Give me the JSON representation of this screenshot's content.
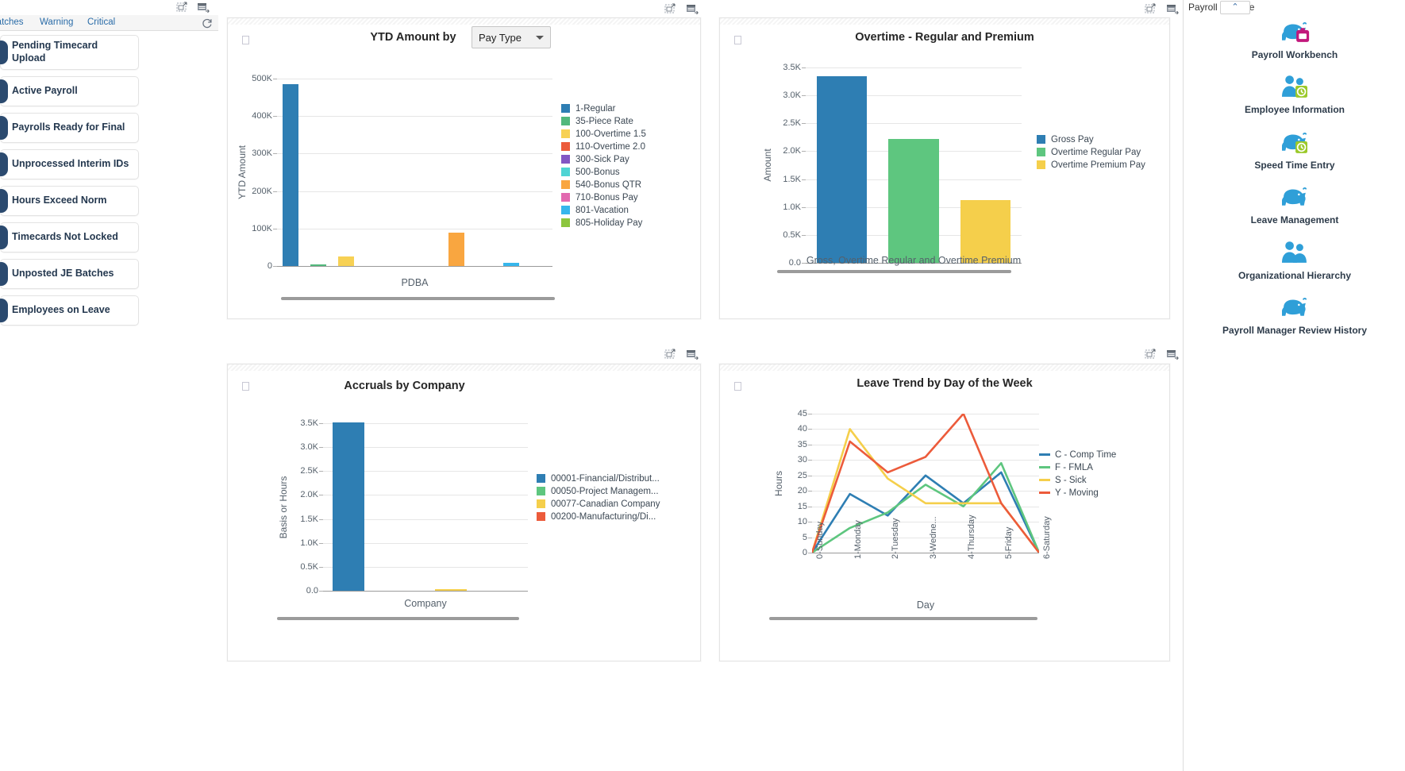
{
  "left_panel": {
    "tabs": [
      {
        "label": "Batches",
        "name": "tab-batches"
      },
      {
        "label": "Warning",
        "name": "tab-warning"
      },
      {
        "label": "Critical",
        "name": "tab-critical"
      }
    ],
    "refresh_icon": "refresh-icon",
    "toolbar_icons": [
      "grid-expand-icon",
      "list-view-icon"
    ],
    "alerts": [
      {
        "label": "Pending Timecard Upload",
        "tall": true
      },
      {
        "label": "Active Payroll",
        "tall": false
      },
      {
        "label": "Payrolls Ready for Final",
        "tall": false
      },
      {
        "label": "Unprocessed Interim IDs",
        "tall": false
      },
      {
        "label": "Hours Exceed Norm",
        "tall": false
      },
      {
        "label": "Timecards Not Locked",
        "tall": false
      },
      {
        "label": "Unposted JE Batches",
        "tall": false
      },
      {
        "label": "Employees on Leave",
        "tall": false
      }
    ]
  },
  "right_panel": {
    "header_title": "Payroll Manage",
    "collapse_label": "⌃",
    "toolbar_icons": [
      "grid-expand-icon",
      "list-view-icon"
    ],
    "items": [
      {
        "label": "Payroll Workbench",
        "icon": "piggy-bank-briefcase-icon"
      },
      {
        "label": "Employee Information",
        "icon": "people-clock-icon"
      },
      {
        "label": "Speed Time Entry",
        "icon": "piggy-bank-clock-icon"
      },
      {
        "label": "Leave Management",
        "icon": "piggy-bank-icon"
      },
      {
        "label": "Organizational Hierarchy",
        "icon": "two-people-icon"
      },
      {
        "label": "Payroll Manager Review History",
        "icon": "piggy-bank-icon"
      }
    ]
  },
  "chart_data": [
    {
      "id": "ytd-amount-by-pay-type",
      "type": "bar",
      "title": "YTD Amount by",
      "selector": {
        "label": "Pay Type",
        "options": [
          "Pay Type"
        ]
      },
      "xlabel": "PDBA",
      "ylabel": "YTD Amount",
      "ylim": [
        0,
        500000
      ],
      "yticks": [
        0,
        100000,
        200000,
        300000,
        400000,
        500000
      ],
      "ytick_labels": [
        "0",
        "100K",
        "200K",
        "300K",
        "400K",
        "500K"
      ],
      "grid": true,
      "legend_position": "right",
      "categories": [
        "1-Regular",
        "35-Piece Rate",
        "100-Overtime 1.5",
        "110-Overtime 2.0",
        "300-Sick Pay",
        "500-Bonus",
        "540-Bonus QTR",
        "710-Bonus Pay",
        "801-Vacation",
        "805-Holiday Pay"
      ],
      "values": [
        486000,
        2500,
        26000,
        0,
        0,
        0,
        90000,
        0,
        8000,
        0
      ],
      "colors": [
        "#2e7eb3",
        "#52b87c",
        "#f7d154",
        "#ec5b3b",
        "#8356c4",
        "#4fd4d4",
        "#f9a640",
        "#e269b0",
        "#36b6ec",
        "#8cc63e"
      ]
    },
    {
      "id": "overtime-regular-and-premium",
      "type": "bar",
      "title": "Overtime - Regular and Premium",
      "xlabel": "Gross, Overtime Regular and Overtime Premium",
      "ylabel": "Amount",
      "ylim": [
        0,
        3500
      ],
      "yticks": [
        0,
        500,
        1000,
        1500,
        2000,
        2500,
        3000,
        3500
      ],
      "ytick_labels": [
        "0.0",
        "0.5K",
        "1.0K",
        "1.5K",
        "2.0K",
        "2.5K",
        "3.0K",
        "3.5K"
      ],
      "grid": true,
      "legend_position": "right",
      "categories": [
        "Gross Pay",
        "Overtime Regular Pay",
        "Overtime Premium Pay"
      ],
      "values": [
        3340,
        2225,
        1125
      ],
      "colors": [
        "#2e7eb3",
        "#5ec67f",
        "#f5cf4b"
      ]
    },
    {
      "id": "accruals-by-company",
      "type": "bar",
      "title": "Accruals by Company",
      "xlabel": "Company",
      "ylabel": "Basis or Hours",
      "ylim": [
        0,
        3500
      ],
      "yticks": [
        0,
        500,
        1000,
        1500,
        2000,
        2500,
        3000,
        3500
      ],
      "ytick_labels": [
        "0.0",
        "0.5K",
        "1.0K",
        "1.5K",
        "2.0K",
        "2.5K",
        "3.0K",
        "3.5K"
      ],
      "grid": true,
      "legend_position": "right",
      "categories": [
        "00001-Financial/Distribut...",
        "00050-Project Managem...",
        "00077-Canadian Company",
        "00200-Manufacturing/Di..."
      ],
      "values": [
        3510,
        0,
        24,
        0
      ],
      "colors": [
        "#2e7eb3",
        "#5ec67f",
        "#f5cf4b",
        "#ec5b3b"
      ]
    },
    {
      "id": "leave-trend-by-day-of-the-week",
      "type": "line",
      "title": "Leave Trend by Day of the Week",
      "xlabel": "Day",
      "ylabel": "Hours",
      "ylim": [
        0,
        45
      ],
      "yticks": [
        0,
        5,
        10,
        15,
        20,
        25,
        30,
        35,
        40,
        45
      ],
      "ytick_labels": [
        "0",
        "5",
        "10",
        "15",
        "20",
        "25",
        "30",
        "35",
        "40",
        "45"
      ],
      "grid": true,
      "legend_position": "right",
      "x": [
        "0-Sunday",
        "1-Monday",
        "2-Tuesday",
        "3-Wedne...",
        "4-Thursday",
        "5-Friday",
        "6-Saturday"
      ],
      "series": [
        {
          "name": "C - Comp Time",
          "color": "#2e7eb3",
          "values": [
            0,
            19,
            12,
            25,
            16,
            26,
            0
          ]
        },
        {
          "name": "F - FMLA",
          "color": "#5ec67f",
          "values": [
            0,
            8,
            13,
            22,
            15,
            29,
            0
          ]
        },
        {
          "name": "S - Sick",
          "color": "#f5cf4b",
          "values": [
            0,
            40,
            24,
            16,
            16,
            16,
            0
          ]
        },
        {
          "name": "Y - Moving",
          "color": "#ec5b3b",
          "values": [
            0,
            36,
            26,
            31,
            45,
            16,
            0
          ]
        }
      ]
    }
  ]
}
